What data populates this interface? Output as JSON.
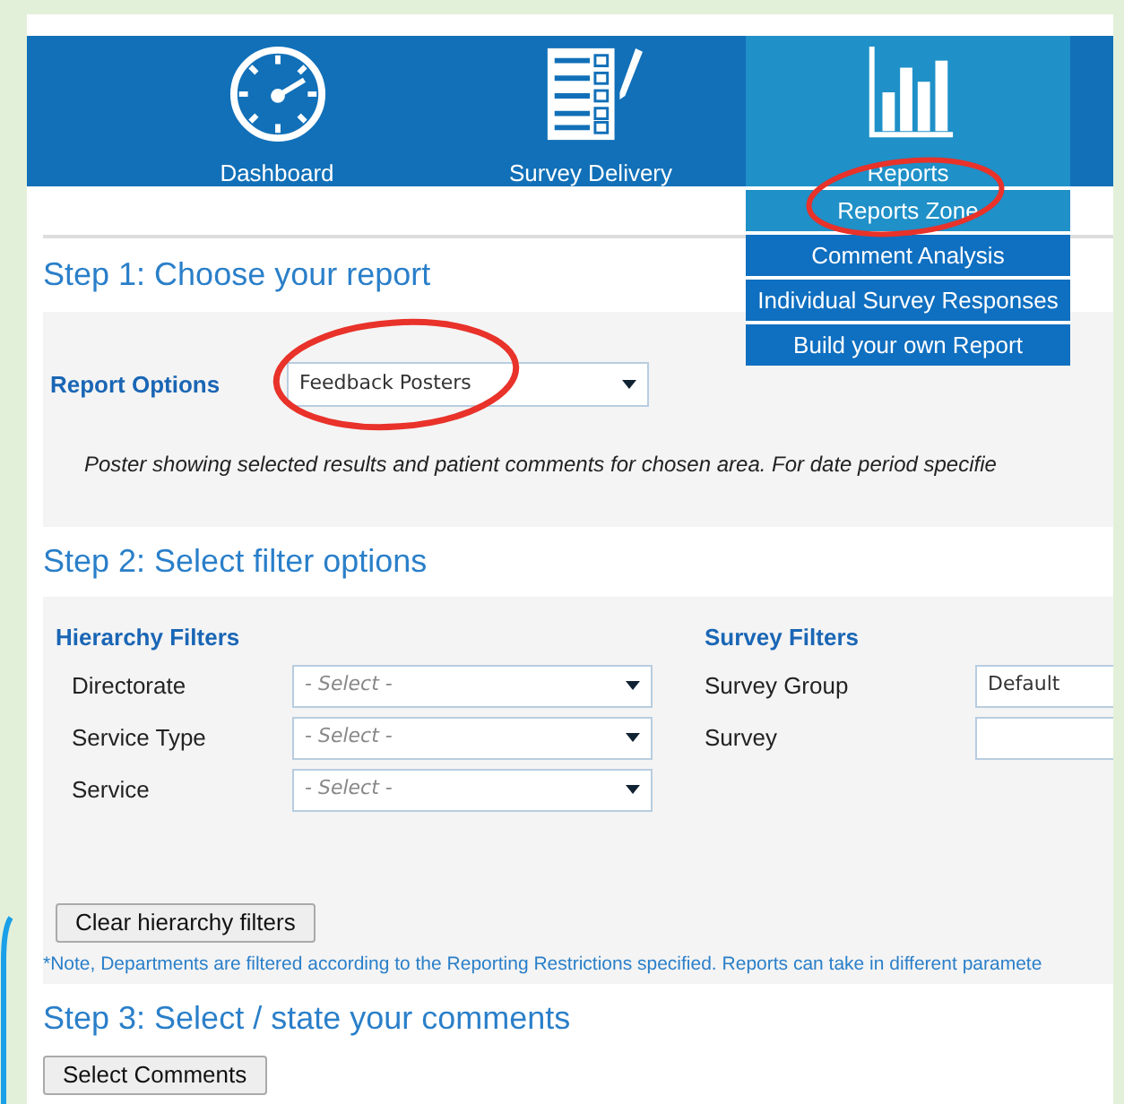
{
  "nav": [
    {
      "label": "Dashboard",
      "kind": "gauge",
      "selected": false
    },
    {
      "label": "Survey Delivery",
      "kind": "checklist",
      "selected": false
    },
    {
      "label": "Reports",
      "kind": "chart",
      "selected": true
    }
  ],
  "reports_menu": [
    {
      "label": "Reports Zone",
      "selected": true
    },
    {
      "label": "Comment Analysis",
      "selected": false
    },
    {
      "label": "Individual Survey Responses",
      "selected": false
    },
    {
      "label": "Build your own Report",
      "selected": false
    }
  ],
  "step1": {
    "heading": "Step 1: Choose your report",
    "label": "Report Options",
    "select": {
      "value": "Feedback Posters"
    },
    "description": "Poster showing selected results and patient comments for chosen area. For date period specifie"
  },
  "step2": {
    "heading": "Step 2: Select filter options",
    "hierarchy": {
      "title": "Hierarchy Filters",
      "rows": [
        {
          "label": "Directorate",
          "placeholder": "- Select -"
        },
        {
          "label": "Service Type",
          "placeholder": "- Select -"
        },
        {
          "label": "Service",
          "placeholder": "- Select -"
        }
      ]
    },
    "survey": {
      "title": "Survey Filters",
      "rows": [
        {
          "label": "Survey Group",
          "value": "Default"
        },
        {
          "label": "Survey"
        }
      ]
    },
    "clear_button": "Clear hierarchy filters",
    "note": "*Note, Departments are filtered according to the Reporting Restrictions specified. Reports can take in different paramete"
  },
  "step3": {
    "heading": "Step 3: Select / state your comments",
    "button": "Select Comments"
  }
}
